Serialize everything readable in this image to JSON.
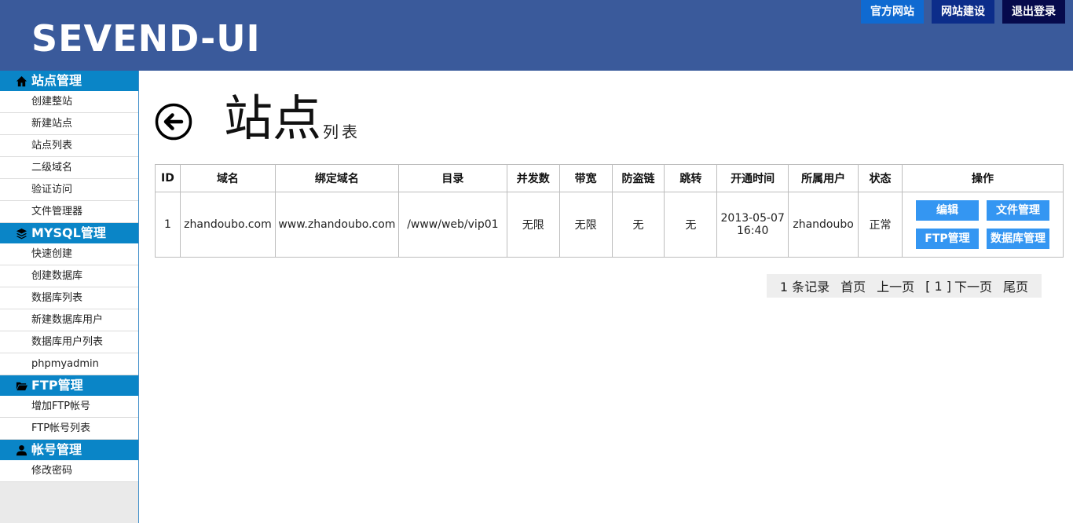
{
  "header": {
    "logo": "SEVEND-UI",
    "buttons": {
      "official": "官方网站",
      "build": "网站建设",
      "logout": "退出登录"
    }
  },
  "sidebar": {
    "groups": [
      {
        "title": "站点管理",
        "icon": "home-icon",
        "items": [
          "创建整站",
          "新建站点",
          "站点列表",
          "二级域名",
          "验证访问",
          "文件管理器"
        ]
      },
      {
        "title": "MYSQL管理",
        "icon": "layers-icon",
        "items": [
          "快速创建",
          "创建数据库",
          "数据库列表",
          "新建数据库用户",
          "数据库用户列表",
          "phpmyadmin"
        ]
      },
      {
        "title": "FTP管理",
        "icon": "folder-icon",
        "items": [
          "增加FTP帐号",
          "FTP帐号列表"
        ]
      },
      {
        "title": "帐号管理",
        "icon": "user-icon",
        "items": [
          "修改密码"
        ]
      }
    ]
  },
  "page": {
    "title": "站点",
    "subtitle": "列表"
  },
  "table": {
    "headers": [
      "ID",
      "域名",
      "绑定域名",
      "目录",
      "并发数",
      "带宽",
      "防盗链",
      "跳转",
      "开通时间",
      "所属用户",
      "状态",
      "操作"
    ],
    "row": {
      "id": "1",
      "domain": "zhandoubo.com",
      "bound": "www.zhandoubo.com",
      "dir": "/www/web/vip01",
      "concurrency": "无限",
      "bandwidth": "无限",
      "hotlink": "无",
      "redirect": "无",
      "date": "2013-05-07",
      "time": "16:40",
      "user": "zhandoubo",
      "status": "正常",
      "ops": {
        "edit": "编辑",
        "files": "文件管理",
        "ftp": "FTP管理",
        "db": "数据库管理"
      }
    }
  },
  "pager": {
    "count": "1 条记录",
    "first": "首页",
    "prev": "上一页",
    "current": "[ 1 ]",
    "next": "下一页",
    "last": "尾页"
  }
}
